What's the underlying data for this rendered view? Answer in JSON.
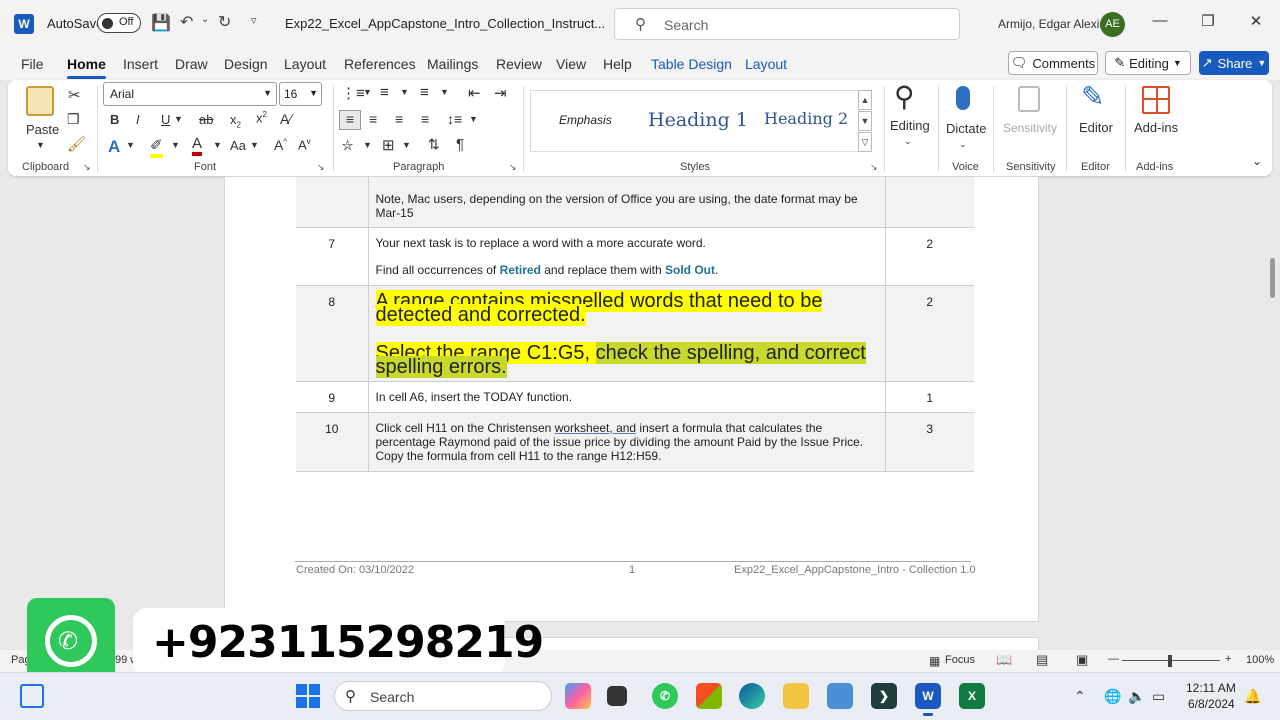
{
  "titlebar": {
    "app_logo": "W",
    "autosave_label": "AutoSave",
    "autosave_state": "Off",
    "doc_title": "Exp22_Excel_AppCapstone_Intro_Collection_Instruct...",
    "search_placeholder": "Search",
    "user_name": "Armijo, Edgar Alexis",
    "user_initials": "AE",
    "icons": [
      "save-icon",
      "undo-icon",
      "redo-icon",
      "customize-qat-icon",
      "minimize-icon",
      "restore-icon",
      "close-icon"
    ]
  },
  "tabs": {
    "items": [
      "File",
      "Home",
      "Insert",
      "Draw",
      "Design",
      "Layout",
      "References",
      "Mailings",
      "Review",
      "View",
      "Help",
      "Table Design",
      "Layout"
    ],
    "active": "Home",
    "comments_label": "Comments",
    "editing_label": "Editing",
    "share_label": "Share"
  },
  "ribbon": {
    "clipboard": {
      "paste_label": "Paste",
      "group_label": "Clipboard"
    },
    "font": {
      "font_name": "Arial",
      "font_size": "16",
      "group_label": "Font",
      "case_label": "Aa"
    },
    "paragraph": {
      "group_label": "Paragraph"
    },
    "styles": {
      "emphasis": "Emphasis",
      "heading1": "Heading 1",
      "heading2": "Heading 2",
      "group_label": "Styles"
    },
    "editing": {
      "label": "Editing"
    },
    "voice": {
      "dictate_label": "Dictate",
      "group_label": "Voice"
    },
    "sensitivity": {
      "label": "Sensitivity",
      "group_label": "Sensitivity"
    },
    "editor": {
      "label": "Editor",
      "group_label": "Editor"
    },
    "addins": {
      "label": "Add-ins",
      "group_label": "Add-ins"
    }
  },
  "document": {
    "rows": [
      {
        "num": "",
        "text": "Note, Mac users, depending on the version of Office you are using, the date format may be Mar-15",
        "points": ""
      },
      {
        "num": "7",
        "line1": "Your next task is to replace a word with a more accurate word.",
        "line2_pre": "Find all occurrences of ",
        "kw1": "Retired",
        "line2_mid": " and replace them with ",
        "kw2": "Sold Out",
        "line2_post": ".",
        "points": "2"
      },
      {
        "num": "8",
        "para1": "A range contains misspelled words that need to be detected and corrected.",
        "para2_a": "Select the range C1:G5, ",
        "para2_b": "check the spelling, and correct spelling errors.",
        "points": "2"
      },
      {
        "num": "9",
        "text": "In cell A6, insert the TODAY function.",
        "points": "1"
      },
      {
        "num": "10",
        "text_a": "Click cell H11 on the Christensen ",
        "text_b": "worksheet, and",
        "text_c": " insert a formula that calculates the percentage Raymond paid of the issue price by dividing the amount Paid by the Issue Price. Copy the formula from cell H11 to the range H12:H59.",
        "points": "3"
      }
    ],
    "footer": {
      "created": "Created On: 03/10/2022",
      "page": "1",
      "doc_name": "Exp22_Excel_AppCapstone_Intro - Collection 1.0"
    }
  },
  "statusbar": {
    "left_partial": "Pag",
    "words_partial": "99 w",
    "focus_label": "Focus",
    "zoom": "100%",
    "zoom_level": 1.0
  },
  "overlay": {
    "phone": "+923115298219"
  },
  "taskbar": {
    "search_placeholder": "Search",
    "time": "12:11 AM",
    "date": "6/8/2024",
    "apps": [
      "copilot-icon",
      "task-view-icon",
      "whatsapp-icon",
      "store-icon",
      "edge-icon",
      "file-explorer-icon",
      "notepad-icon",
      "terminal-icon",
      "word-icon",
      "excel-icon"
    ]
  },
  "colors": {
    "accent": "#185abd",
    "keyword": "#1f7391",
    "highlight_yellow": "#ffff00",
    "highlight_green": "#c6d92c",
    "whatsapp": "#2ec85b"
  }
}
